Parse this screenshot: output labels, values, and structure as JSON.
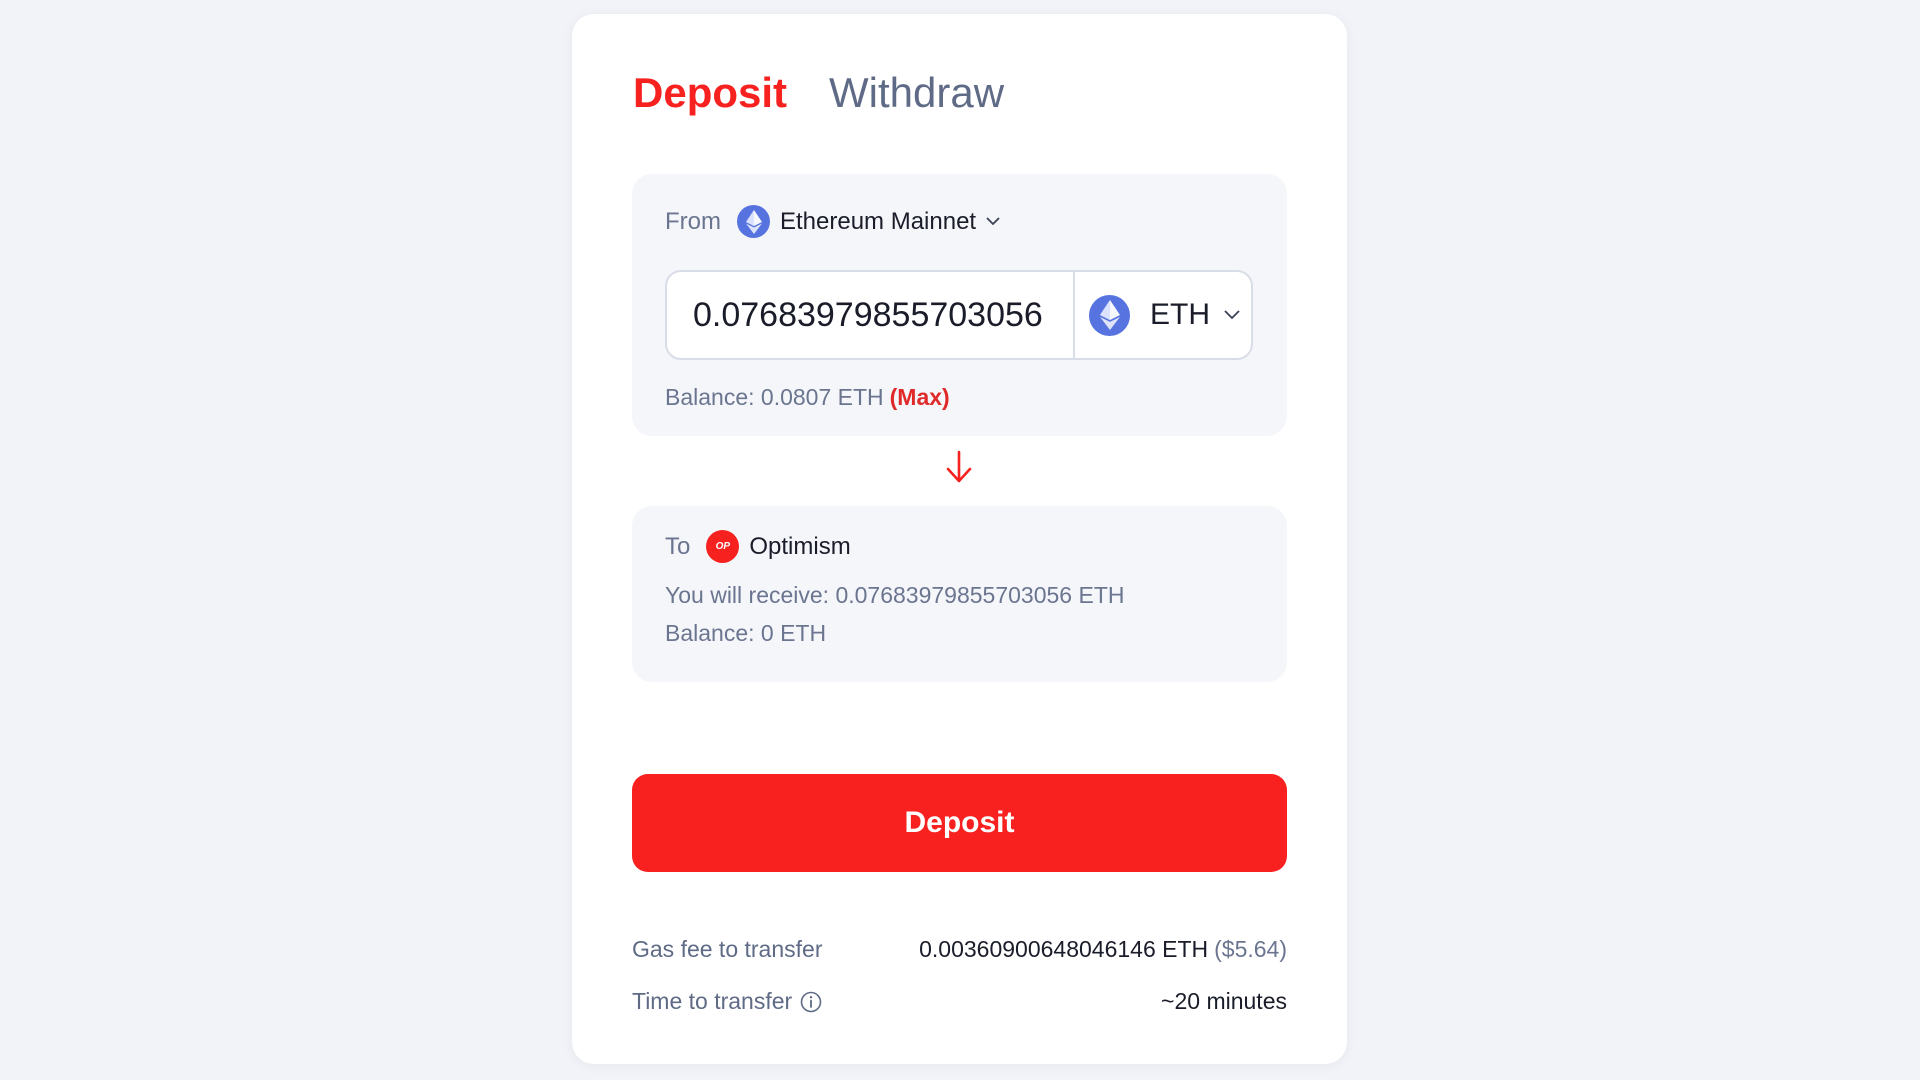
{
  "tabs": {
    "deposit": "Deposit",
    "withdraw": "Withdraw"
  },
  "from": {
    "label": "From",
    "network": "Ethereum Mainnet",
    "network_icon": "ethereum-icon",
    "amount": "0.07683979855703056",
    "token": "ETH",
    "token_icon": "ethereum-icon",
    "balance": "Balance: 0.0807 ETH",
    "max_label": "(Max)"
  },
  "to": {
    "label": "To",
    "network": "Optimism",
    "network_icon_text": "OP",
    "receive": "You will receive: 0.07683979855703056 ETH",
    "balance": "Balance: 0 ETH"
  },
  "deposit_button": "Deposit",
  "fees": {
    "gas_label": "Gas fee to transfer",
    "gas_value": "0.00360900648046146 ETH",
    "gas_usd": "($5.64)",
    "time_label": "Time to transfer",
    "time_value": "~20 minutes"
  },
  "colors": {
    "accent": "#f7211f",
    "ethereum": "#5673e0",
    "background": "#f1f3f8"
  }
}
